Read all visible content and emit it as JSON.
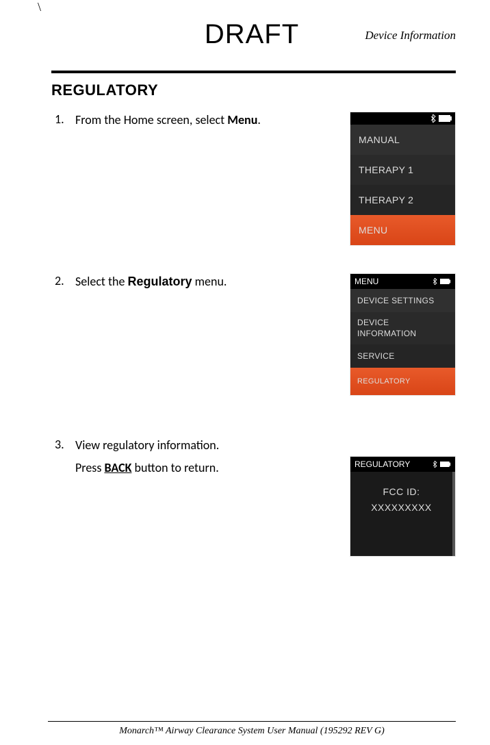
{
  "top_mark": "\\",
  "draft": "DRAFT",
  "section_label": "Device Information",
  "heading": "REGULATORY",
  "steps": {
    "s1": {
      "num": "1.",
      "pre": "From the Home screen, select ",
      "bold": "Menu",
      "post": "."
    },
    "s2": {
      "num": "2.",
      "pre": "Select the ",
      "bold": "Regulatory",
      "post": " menu."
    },
    "s3": {
      "num": "3.",
      "line1": "View regulatory information.",
      "line2_pre": "Press ",
      "line2_bold": "BACK",
      "line2_post": " button to return."
    }
  },
  "screen1": {
    "items": [
      "MANUAL",
      "THERAPY 1",
      "THERAPY 2",
      "MENU"
    ]
  },
  "screen2": {
    "title": "MENU",
    "items": [
      "DEVICE SETTINGS",
      "DEVICE INFORMATION",
      "SERVICE",
      "REGULATORY"
    ]
  },
  "screen3": {
    "title": "REGULATORY",
    "line1": "FCC ID:",
    "line2": "XXXXXXXXX"
  },
  "footer": "Monarch™ Airway Clearance System User Manual (195292 REV G)"
}
